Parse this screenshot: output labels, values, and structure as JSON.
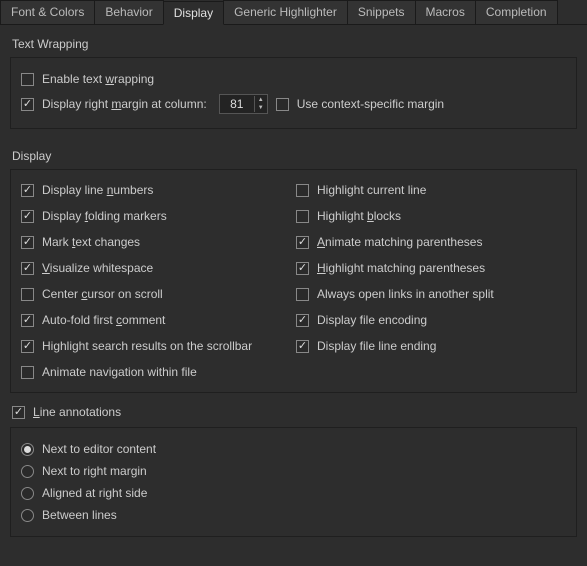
{
  "tabs": {
    "t0": "Font & Colors",
    "t1": "Behavior",
    "t2": "Display",
    "t3": "Generic Highlighter",
    "t4": "Snippets",
    "t5": "Macros",
    "t6": "Completion"
  },
  "sections": {
    "text_wrapping": "Text Wrapping",
    "display": "Display"
  },
  "wrap": {
    "enable": "Enable text ",
    "enable_u": "w",
    "enable_suf": "rapping",
    "margin": "Display right ",
    "margin_u": "m",
    "margin_suf": "argin at column:",
    "margin_val": "81",
    "ctx": "Use context-specific margin"
  },
  "disp": {
    "line_num_pre": "Display line ",
    "line_num_u": "n",
    "line_num_suf": "umbers",
    "fold_pre": "Display ",
    "fold_u": "f",
    "fold_suf": "olding markers",
    "mark_pre": "Mark ",
    "mark_u": "t",
    "mark_suf": "ext changes",
    "vis_u": "V",
    "vis_suf": "isualize whitespace",
    "center_pre": "Center ",
    "center_u": "c",
    "center_suf": "ursor on scroll",
    "autofold_pre": "Auto-fold first ",
    "autofold_u": "c",
    "autofold_suf": "omment",
    "hlsr": "Highlight search results on the scrollbar",
    "animnav": "Animate navigation within file",
    "hlcur": "Highlight current line",
    "hlblk_pre": "Highlight ",
    "hlblk_u": "b",
    "hlblk_suf": "locks",
    "anim_u": "A",
    "anim_suf": "nimate matching parentheses",
    "hlparen_u": "H",
    "hlparen_suf": "ighlight matching parentheses",
    "always": "Always open links in another split",
    "enc": "Display file encoding",
    "ending": "Display file line ending"
  },
  "ann": {
    "title_u": "L",
    "title_suf": "ine annotations",
    "r0": "Next to editor content",
    "r1": "Next to right margin",
    "r2": "Aligned at right side",
    "r3": "Between lines"
  }
}
